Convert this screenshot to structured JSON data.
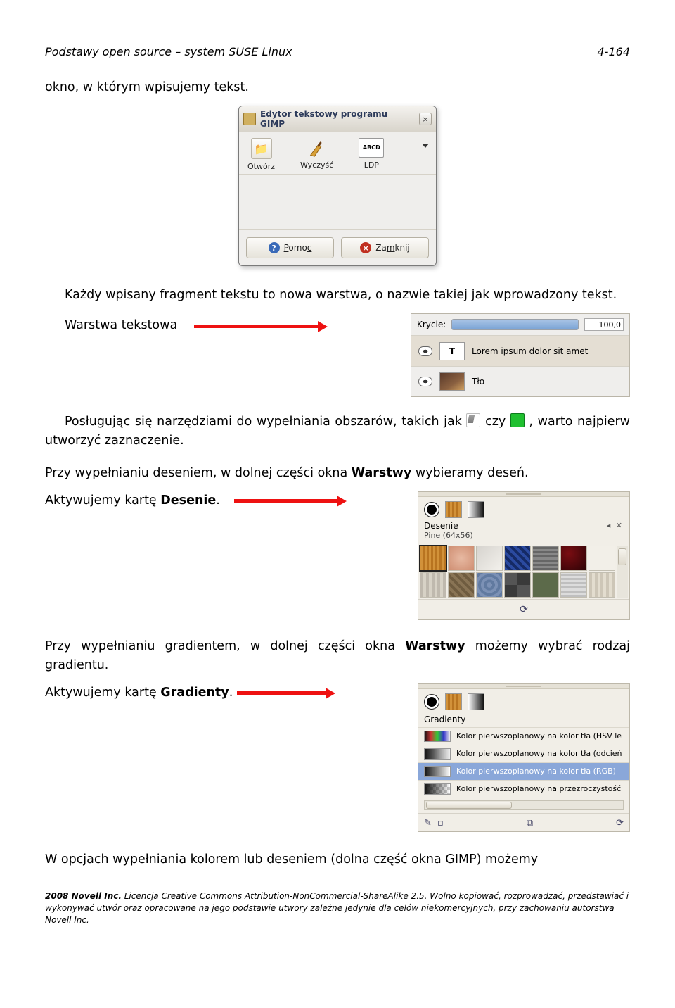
{
  "header": {
    "title_left": "Podstawy open  source – system SUSE Linux",
    "page_right": "4-164"
  },
  "intro_line": "okno, w którym wpisujemy tekst.",
  "editor": {
    "title": "Edytor tekstowy programu GIMP",
    "tool_open": "Otwórz",
    "tool_clear": "Wyczyść",
    "abcd_top": "ABCD",
    "abcd_bottom": "LDP",
    "btn_help": "Pomoc",
    "btn_close": "Zamknij"
  },
  "after_editor": {
    "p1a": "Każdy wpisany fragment tekstu to nowa warstwa, o nazwie takiej jak wprowadzony tekst.",
    "label_textlayer": "Warstwa tekstowa"
  },
  "krycie": {
    "label": "Krycie:",
    "value": "100,0",
    "layer_text": "Lorem ipsum dolor sit amet",
    "layer_bg": "Tło"
  },
  "para_tools": {
    "pre": "Posługując się narzędziami do wypełniania obszarów, takich jak ",
    "mid": " czy ",
    "post": ", warto najpierw utworzyć zaznaczenie."
  },
  "para_desen": "Przy wypełnianiu deseniem, w dolnej części okna ",
  "para_desen_term": "Warstwy",
  "para_desen_tail": " wybieramy deseń.",
  "para_desen_act_a": "Aktywujemy kartę ",
  "para_desen_act_b": "Desenie",
  "para_desen_act_c": ".",
  "desenie": {
    "tab_label": "Desenie",
    "sub_label": "Pine (64x56)",
    "footer_refresh": "⟳"
  },
  "para_grad": "Przy wypełnianiu gradientem, w dolnej części okna ",
  "para_grad_term": "Warstwy",
  "para_grad_tail": " możemy wybrać rodzaj gradientu.",
  "para_grad_act_a": "Aktywujemy kartę ",
  "para_grad_act_b": "Gradienty",
  "para_grad_act_c": ".",
  "grad": {
    "tab_label": "Gradienty",
    "rows": [
      "Kolor pierwszoplanowy na kolor tła (HSV le",
      "Kolor pierwszoplanowy na kolor tła (odcień",
      "Kolor pierwszoplanowy na kolor tła (RGB)",
      "Kolor pierwszoplanowy na przezroczystość"
    ]
  },
  "final_para": "W opcjach wypełniania kolorem lub deseniem (dolna część okna GIMP) możemy",
  "footer": {
    "l1a": "2008 Novell Inc.",
    "l1b": " Licencja Creative Commons Attribution-NonCommercial-ShareAlike 2.5. Wolno kopiować, rozprowadzać, przedstawiać i wykonywać utwór oraz opracowane na jego podstawie utwory zależne jedynie dla celów niekomercyjnych, przy zachowaniu autorstwa Novell Inc."
  }
}
